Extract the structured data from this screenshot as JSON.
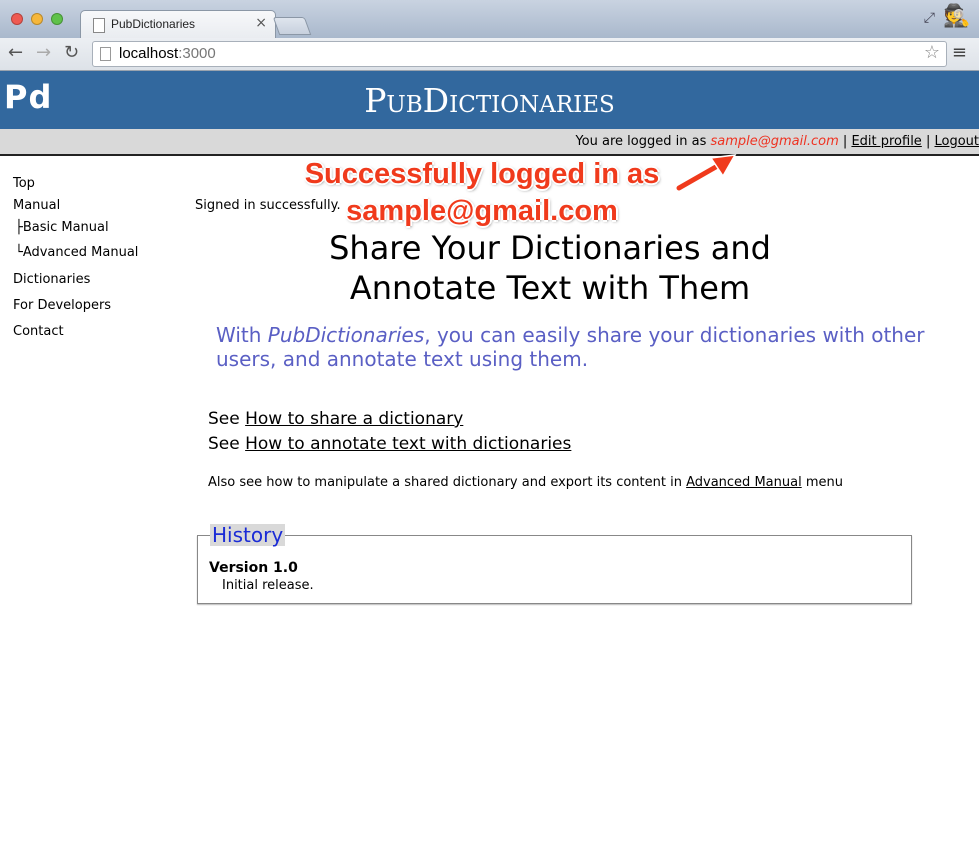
{
  "browser": {
    "tab_title": "PubDictionaries",
    "tab_close": "×",
    "url_host": "localhost",
    "url_port": ":3000",
    "back_glyph": "←",
    "forward_glyph": "→",
    "reload_glyph": "↻",
    "star_glyph": "☆",
    "menu_glyph": "≡"
  },
  "site": {
    "logo": "Pd",
    "title": "PubDictionaries",
    "header_color": "#32689e"
  },
  "userbar": {
    "prefix": "You are logged in as",
    "email": "sample@gmail.com",
    "separator": "|",
    "edit_profile": "Edit profile",
    "logout": "Logout"
  },
  "sidebar": {
    "items": [
      {
        "label": "Top"
      },
      {
        "label": "Manual"
      },
      {
        "label": "├Basic Manual"
      },
      {
        "label": "└Advanced Manual"
      },
      {
        "label": "Dictionaries"
      },
      {
        "label": "For Developers"
      },
      {
        "label": "Contact"
      }
    ]
  },
  "main": {
    "flash": "Signed in successfully.",
    "heading_line1": "Share Your Dictionaries and",
    "heading_line2": "Annotate Text with Them",
    "lead_pre": "With ",
    "lead_em": "PubDictionaries",
    "lead_post": ", you can easily share your dictionaries with other users, and annotate text using them.",
    "see_word": "See",
    "see_link1": "How to share a dictionary",
    "see_link2": "How to annotate text with dictionaries",
    "also_pre": "Also see how to manipulate a shared dictionary and export its content in ",
    "also_link": "Advanced Manual",
    "also_post": " menu"
  },
  "history": {
    "legend": "History",
    "version": "Version 1.0",
    "note": "Initial release."
  },
  "annotation": {
    "line1": "Successfully logged in as",
    "line2": "sample@gmail.com",
    "color": "#f03a1c"
  }
}
